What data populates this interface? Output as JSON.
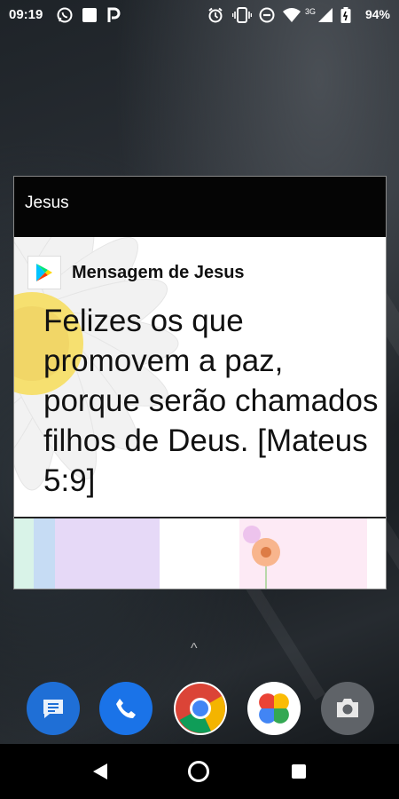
{
  "status_bar": {
    "time": "09:19",
    "battery_percent": "94%",
    "network_label": "3G",
    "icons": [
      "whatsapp-icon",
      "notification-square-icon",
      "p-icon",
      "alarm-icon",
      "vibrate-icon",
      "dnd-icon",
      "wifi-icon",
      "signal-icon",
      "battery-icon"
    ]
  },
  "overlay": {
    "title": "Jesus",
    "header_icon": "play-store-icon",
    "message_title": "Mensagem de Jesus",
    "verse": "Felizes os que promovem a paz, porque serão chamados filhos de Deus. [Mateus 5:9]"
  },
  "launcher": {
    "app_drawer_chevron": "^",
    "dock": [
      {
        "name": "messages",
        "icon": "messages-icon",
        "color": "#1a73e8"
      },
      {
        "name": "phone",
        "icon": "phone-icon",
        "color": "#1a73e8"
      },
      {
        "name": "chrome",
        "icon": "chrome-icon",
        "color": "#db4437"
      },
      {
        "name": "photos",
        "icon": "photos-icon",
        "color": "#f4b400"
      },
      {
        "name": "camera",
        "icon": "camera-icon",
        "color": "#757575"
      }
    ]
  },
  "nav_bar": {
    "buttons": [
      "back-button",
      "home-button",
      "recents-button"
    ]
  }
}
